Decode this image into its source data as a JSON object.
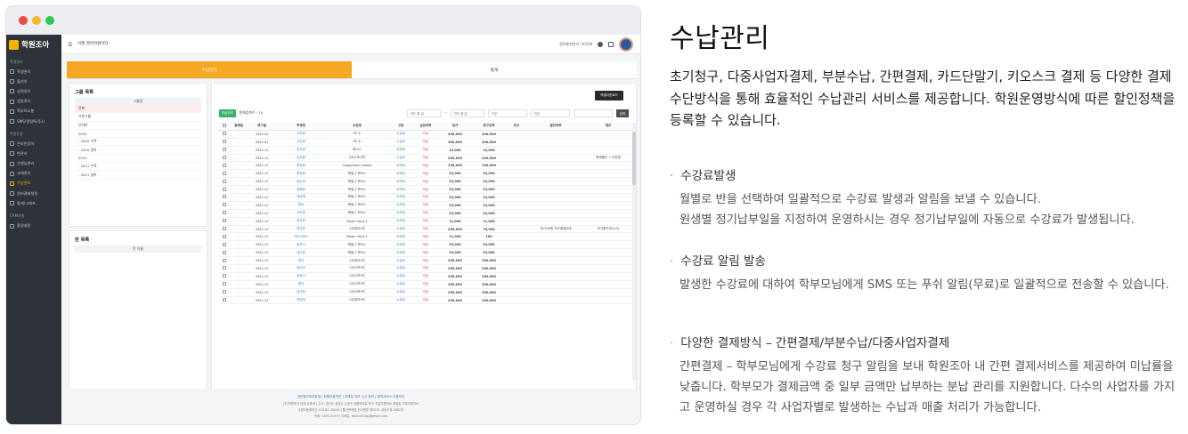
{
  "mockup": {
    "logo_text": "학원조아",
    "top_title": "이젠 영어학원이다",
    "top_right_text": "원아봉천천석 가미1회",
    "sidebar": {
      "sections": [
        "학생관리",
        "학원운영",
        "CRM자원"
      ],
      "items_group1": [
        "학생관리",
        "출석부",
        "성적관리",
        "상담관리",
        "학부모소통",
        "SMS/알림톡/푸시"
      ],
      "items_group2": [
        "온라인강의",
        "반관리",
        "선생님관리",
        "교재관리",
        "수납관리",
        "원비결제설정",
        "통계/그래프"
      ],
      "items_group3": [
        "환경설정"
      ]
    },
    "tabs": [
      "수납관리",
      "통계"
    ],
    "group_panel": {
      "title": "그룹 목록",
      "header": "그룹명",
      "rows": [
        "전체",
        "기본그룹",
        "유치반",
        "2020",
        "- 2020 수학",
        "- 2020 영어",
        "2021",
        "- 2021 수학",
        "- 2021 영어"
      ]
    },
    "class_panel": {
      "title": "반 목록",
      "header": "반 이름"
    },
    "main": {
      "excel_button": "엑셀다운로드",
      "filter_tag": "미납관리",
      "count_text": "현재검색수 : 74",
      "date_from": "연도-월-일",
      "date_to": "연도-월-일",
      "select1": "구분",
      "select2": "미납",
      "search_button": "검색",
      "columns": [
        "",
        "결제일",
        "청구월",
        "학생명",
        "수업명",
        "구분",
        "납입여부",
        "원가",
        "청구금액",
        "비고",
        "할인여부",
        "메모"
      ],
      "rows": [
        [
          "",
          "2023-02",
          "서지영",
          "PS 수",
          "수강료",
          "미납",
          "200,000",
          "200,000",
          "",
          "",
          ""
        ],
        [
          "",
          "2023-01",
          "서지영",
          "PS 수",
          "수강료",
          "미납",
          "200,000",
          "200,000",
          "",
          "",
          ""
        ],
        [
          "",
          "2022-12",
          "최우현",
          "파닉스",
          "교재비",
          "미납",
          "12,000",
          "12,000",
          "",
          "",
          ""
        ],
        [
          "",
          "2022-12",
          "김교원",
          "2교수학고반",
          "수강료",
          "미납",
          "250,000",
          "220,000",
          "",
          "",
          "형제할인 + 쿠폰형"
        ],
        [
          "",
          "2022-12",
          "최우현",
          "Cappytown Grade1",
          "교재비",
          "미납",
          "130,000",
          "130,000",
          "",
          "",
          ""
        ],
        [
          "",
          "2022-12",
          "최우현",
          "책벌 2 파닉스",
          "교재비",
          "미납",
          "23,000",
          "23,000",
          "",
          "",
          ""
        ],
        [
          "",
          "2022-12",
          "정소연",
          "책벌 2 파닉스",
          "교재비",
          "미납",
          "23,000",
          "23,000",
          "",
          "",
          ""
        ],
        [
          "",
          "2022-12",
          "윤해요",
          "책벌 2 파닉스",
          "교재비",
          "미납",
          "23,000",
          "23,000",
          "",
          "",
          ""
        ],
        [
          "",
          "2022-12",
          "백승재",
          "책벌 2 파닉스",
          "교재비",
          "미납",
          "23,000",
          "23,000",
          "",
          "",
          ""
        ],
        [
          "",
          "2022-12",
          "명이",
          "책벌 2 파닉스",
          "교재비",
          "미납",
          "23,000",
          "23,000",
          "",
          "",
          ""
        ],
        [
          "",
          "2022-12",
          "서지영",
          "책벌 2 파닉스",
          "교재비",
          "미납",
          "23,000",
          "23,000",
          "",
          "",
          ""
        ],
        [
          "",
          "2022-12",
          "최우현",
          "Power Voca 1",
          "교재비",
          "미납",
          "11,000",
          "11,000",
          "",
          "",
          ""
        ],
        [
          "",
          "2022-12",
          "최우현",
          "2교영어1반",
          "수강료",
          "미납",
          "250,000",
          "76,900",
          "",
          "76,900원 카드결제/B초",
          "조기환구비(1/3)"
        ],
        [
          "",
          "2022-12",
          "크리스탁스",
          "Power Voca 1",
          "교재비",
          "미납",
          "11,000",
          "100",
          "",
          "",
          ""
        ],
        [
          "",
          "2022-12",
          "송하서",
          "책벌 2 파닉스",
          "교재비",
          "미납",
          "23,000",
          "23,000",
          "",
          "",
          ""
        ],
        [
          "",
          "2022-12",
          "김아현",
          "책벌 2 파닉스",
          "교재비",
          "미납",
          "23,000",
          "23,000",
          "",
          "",
          ""
        ],
        [
          "",
          "2022-12",
          "명이",
          "2교영어1반",
          "수강료",
          "미납",
          "250,000",
          "250,000",
          "",
          "",
          ""
        ],
        [
          "",
          "2022-12",
          "정소연",
          "2교수학1반",
          "수강료",
          "미납",
          "250,000",
          "250,000",
          "",
          "",
          ""
        ],
        [
          "",
          "2022-12",
          "송하서",
          "2교수학1반",
          "수강료",
          "미납",
          "250,000",
          "250,000",
          "",
          "",
          ""
        ],
        [
          "",
          "2022-12",
          "명이",
          "2교수학1반",
          "수강료",
          "미납",
          "250,000",
          "250,000",
          "",
          "",
          ""
        ],
        [
          "",
          "2022-12",
          "김아현",
          "2교수학1반",
          "수강료",
          "미납",
          "250,000",
          "250,000",
          "",
          "",
          ""
        ],
        [
          "",
          "2022-12",
          "백승재",
          "2교영어1반",
          "수강료",
          "미납",
          "250,000",
          "250,000",
          "",
          "",
          ""
        ]
      ]
    },
    "footer": {
      "links": "개인정보처리방침 | 회원이용약관 | 이메일 정보 수신 동의 | 원격서비스 이용약관",
      "line1": "(주)학원조아 대표:유종국 | 주소: 경기도 성남시 수정구 대왕판교로 815 기업지원허브 창업존 기업지원허브",
      "line2": "사업자등록번호 144-81-00044 | 통신판매업 신고번호 제2021-성남수정-0562호",
      "line3": "전화: 1833-5079 | 이메일: festcutmap@gmail.com"
    }
  },
  "content": {
    "heading": "수납관리",
    "description": "초기청구, 다중사업자결제, 부분수납, 간편결제, 카드단말기, 키오스크 결제 등 다양한 결제수단방식을 통해 효율적인 수납관리 서비스를 제공합니다. 학원운영방식에 따른 할인정책을 등록할 수 있습니다.",
    "features": [
      {
        "title": "수강료발생",
        "body": "월별로 반을 선택하여 일괄적으로 수강료 발생과 알림을 보낼 수 있습니다.\n원생별 정기납부일을 지정하여 운영하시는 경우 정기납부일에 자동으로 수강료가 발생됩니다."
      },
      {
        "title": "수강료 알림 발송",
        "body": "발생한 수강료에 대하여 학부모님에게 SMS 또는 푸쉬 알림(무료)로 일괄적으로 전송할 수 있습니다."
      },
      {
        "title": "다양한 결제방식 – 간편결제/부분수납/다중사업자결제",
        "body": "간편결제 – 학부모님에게 수강료 청구 알림을 보내 학원조아 내 간편 결제서비스를 제공하여 미납률을 낮춥니다. 학부모가 결제금액 중 일부 금액만 납부하는 분납 관리를 지원합니다. 다수의 사업자를 가지고 운영하실 경우 각 사업자별로 발생하는 수납과 매출 처리가 가능합니다."
      }
    ]
  }
}
